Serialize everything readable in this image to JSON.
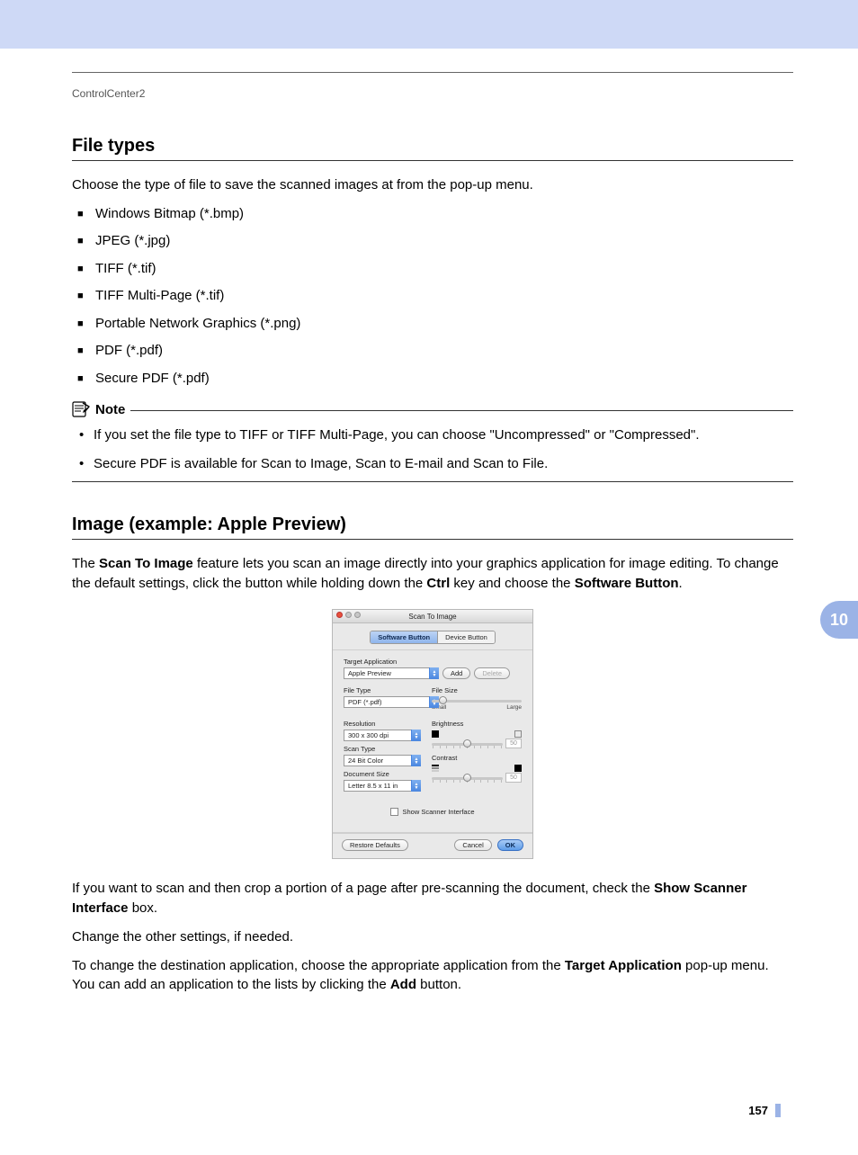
{
  "header": {
    "running": "ControlCenter2"
  },
  "chapter_tab": "10",
  "page_number": "157",
  "section1": {
    "title": "File types",
    "intro": "Choose the type of file to save the scanned images at from the pop-up menu.",
    "items": [
      "Windows Bitmap (*.bmp)",
      "JPEG (*.jpg)",
      "TIFF (*.tif)",
      "TIFF Multi-Page (*.tif)",
      "Portable Network Graphics (*.png)",
      "PDF (*.pdf)",
      "Secure PDF (*.pdf)"
    ],
    "note_label": "Note",
    "notes": [
      "If you set the file type to TIFF or TIFF Multi-Page, you can choose \"Uncompressed\" or \"Compressed\".",
      "Secure PDF is available for Scan to Image, Scan to E-mail and Scan to File."
    ]
  },
  "section2": {
    "title": "Image (example: Apple Preview)",
    "para1_pre": "The ",
    "para1_b1": "Scan To Image",
    "para1_mid": " feature lets you scan an image directly into your graphics application for image editing. To change the default settings, click the button while holding down the ",
    "para1_b2": "Ctrl",
    "para1_mid2": " key and choose the ",
    "para1_b3": "Software Button",
    "para1_end": ".",
    "para2_pre": "If you want to scan and then crop a portion of a page after pre-scanning the document, check the ",
    "para2_b1": "Show Scanner Interface",
    "para2_end": " box.",
    "para3": "Change the other settings, if needed.",
    "para4_pre": "To change the destination application, choose the appropriate application from the ",
    "para4_b1": "Target Application",
    "para4_mid": " pop-up menu. You can add an application to the lists by clicking the ",
    "para4_b2": "Add",
    "para4_end": " button."
  },
  "dialog": {
    "title": "Scan To Image",
    "tabs": {
      "software": "Software Button",
      "device": "Device Button"
    },
    "target_app_label": "Target Application",
    "target_app_value": "Apple Preview",
    "add_btn": "Add",
    "delete_btn": "Delete",
    "file_type_label": "File Type",
    "file_type_value": "PDF (*.pdf)",
    "file_size_label": "File Size",
    "file_size_small": "Small",
    "file_size_large": "Large",
    "resolution_label": "Resolution",
    "resolution_value": "300 x 300 dpi",
    "scan_type_label": "Scan Type",
    "scan_type_value": "24 Bit Color",
    "doc_size_label": "Document Size",
    "doc_size_value": "Letter  8.5 x 11 in",
    "brightness_label": "Brightness",
    "brightness_value": "50",
    "contrast_label": "Contrast",
    "contrast_value": "50",
    "show_scanner": "Show Scanner Interface",
    "restore": "Restore Defaults",
    "cancel": "Cancel",
    "ok": "OK"
  }
}
